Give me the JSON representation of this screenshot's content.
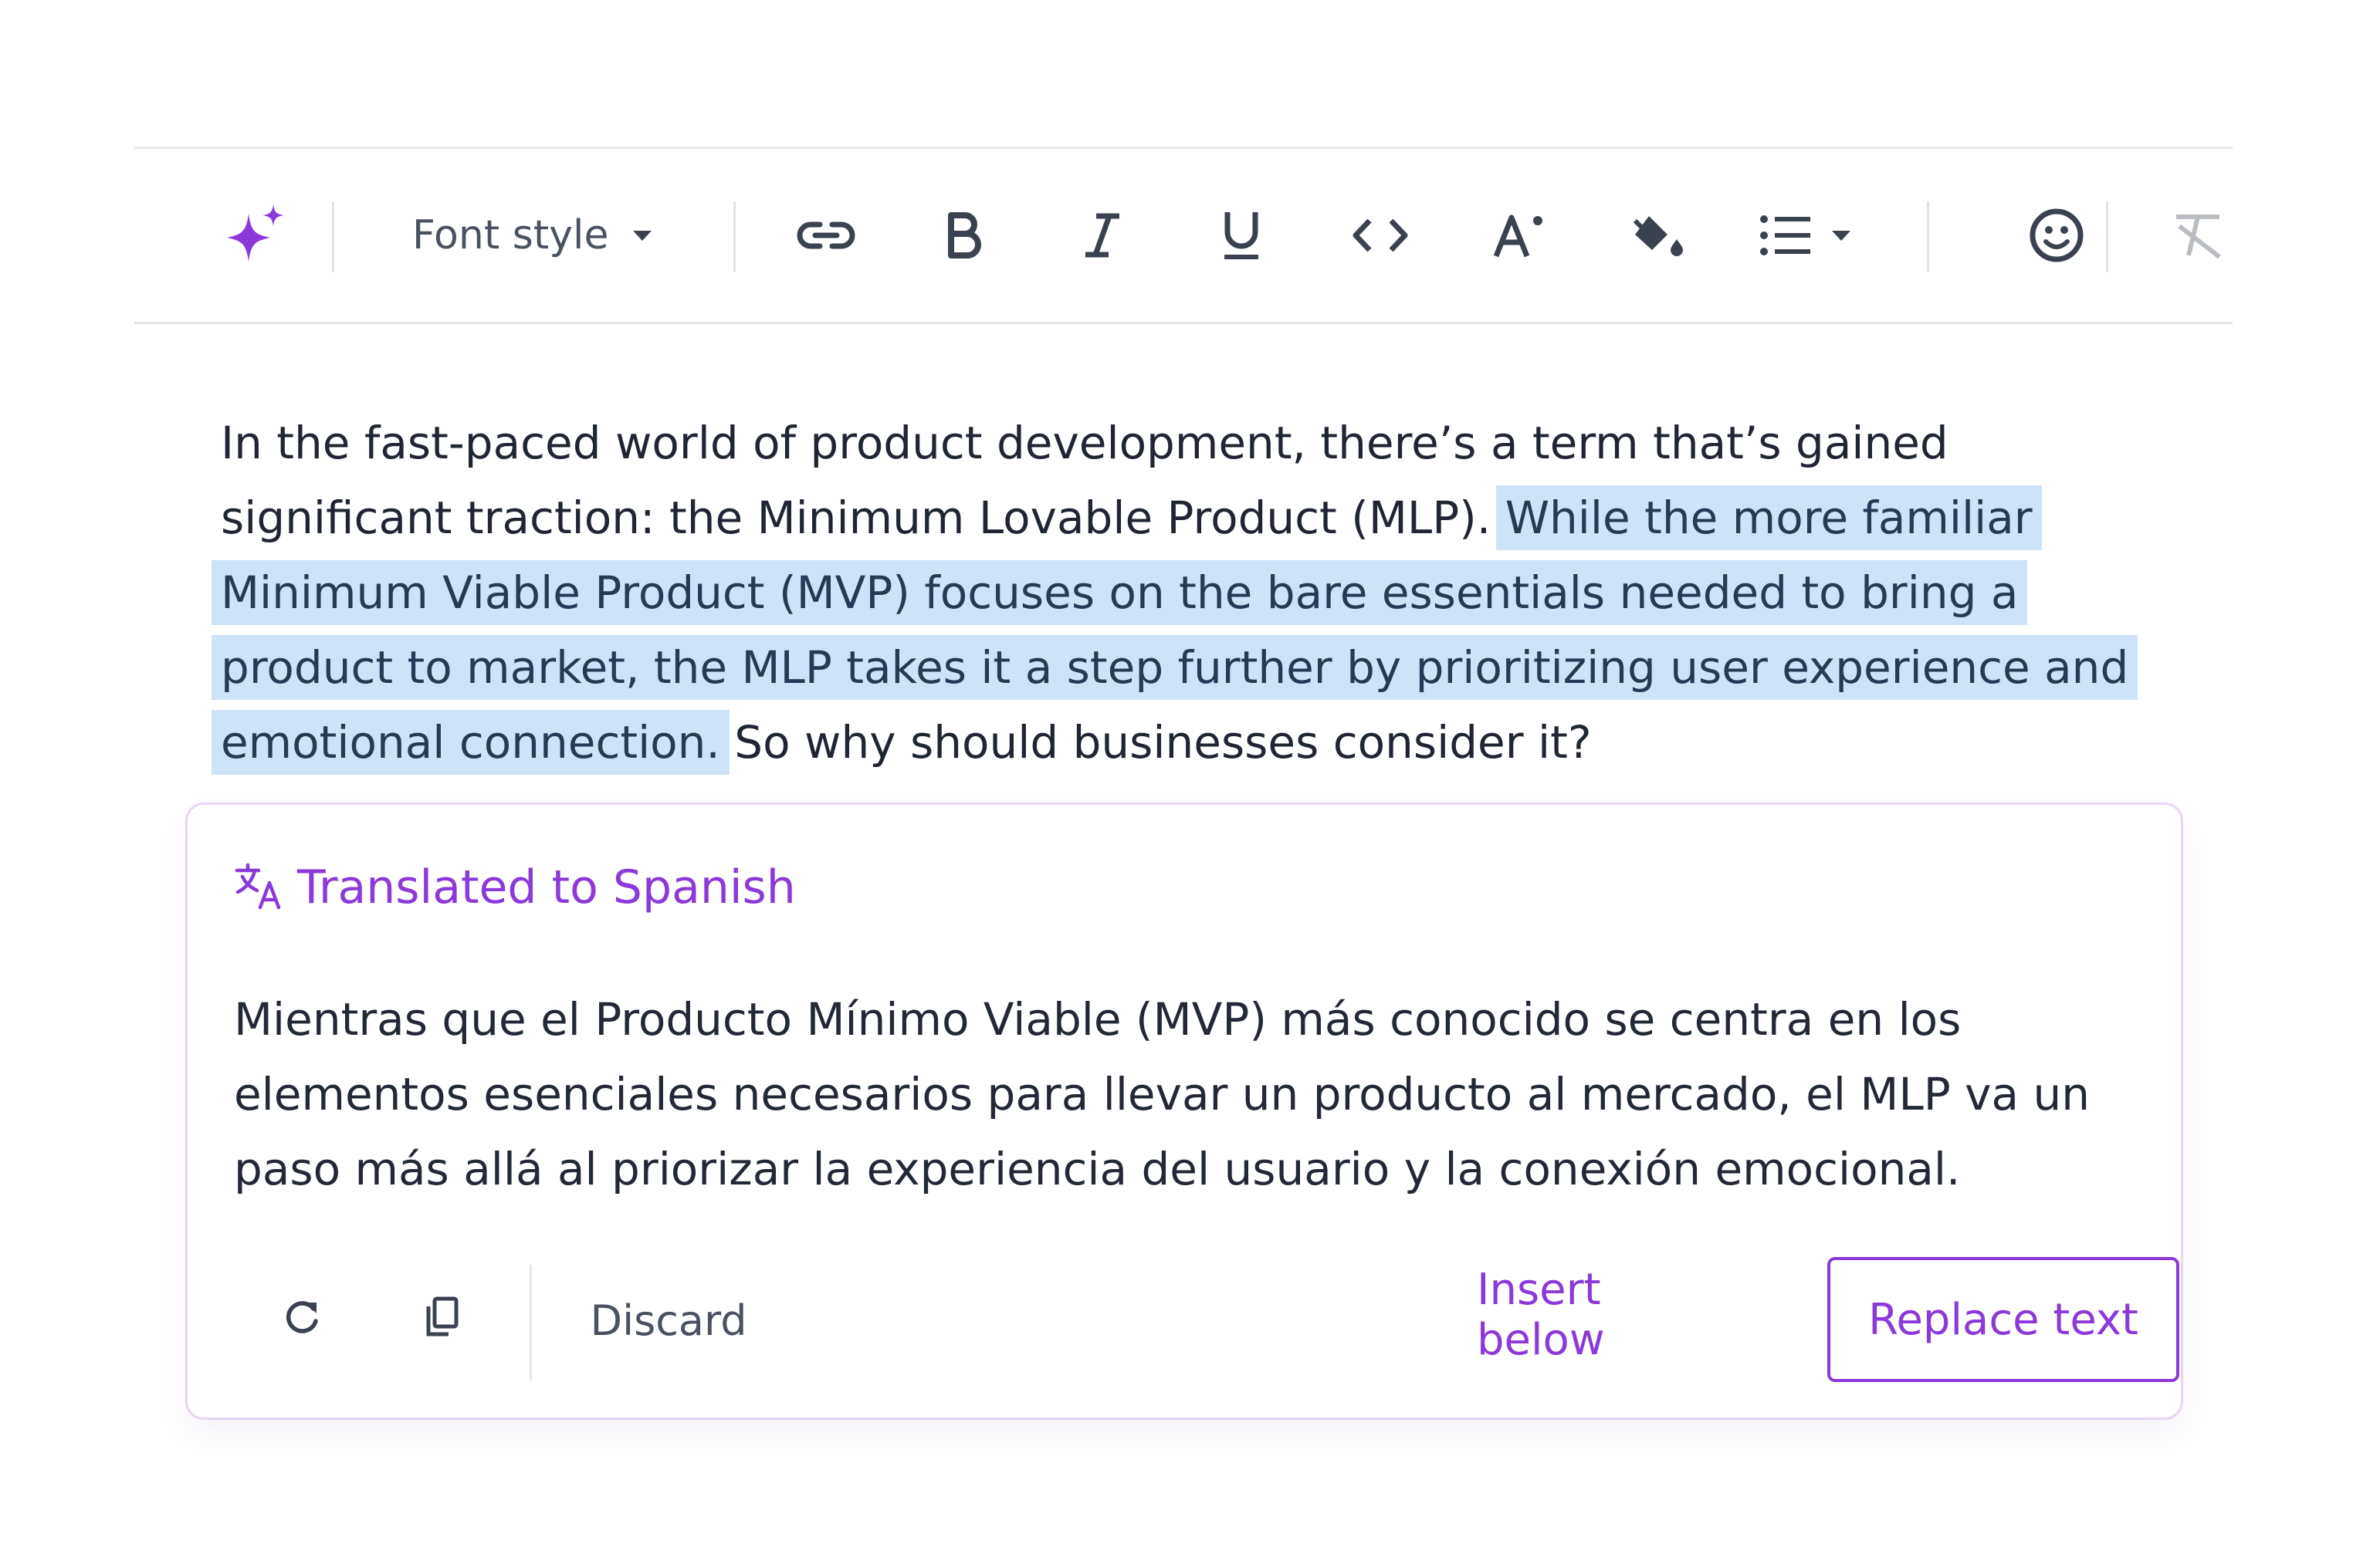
{
  "colors": {
    "accent": "#8b39d8",
    "selection_highlight": "#cfe3f8",
    "text": "#1f2533",
    "muted": "#4a5261",
    "divider": "#e4e6ea"
  },
  "toolbar": {
    "ai_icon": "sparkle-icon",
    "font_style_label": "Font style",
    "buttons": [
      "link-icon",
      "bold-icon",
      "italic-icon",
      "underline-icon",
      "code-icon",
      "text-size-icon",
      "fill-color-icon",
      "bullet-list-icon",
      "emoji-icon",
      "clear-format-icon"
    ]
  },
  "editor": {
    "text_before": "In the fast-paced world of product development, there’s a term that’s gained significant traction: the Minimum Lovable Product (MLP). ",
    "selected_text": "While the more familiar Minimum Viable Product (MVP) focuses on the bare essentials needed to bring a product to market, the MLP takes it a step further by prioritizing user experience and emotional connection.",
    "text_after": " So why should businesses consider it?"
  },
  "translation": {
    "header_icon": "translate-icon",
    "title": "Translated to Spanish",
    "text": "Mientras que el Producto Mínimo Viable (MVP) más conocido se centra en los elementos esenciales necesarios para llevar un producto al mercado, el MLP va un paso más allá al priorizar la experiencia del usuario y la conexión emocional.",
    "actions": {
      "regenerate_icon": "refresh-icon",
      "copy_icon": "copy-icon",
      "discard_label": "Discard",
      "insert_below_label": "Insert below",
      "replace_text_label": "Replace text"
    }
  }
}
